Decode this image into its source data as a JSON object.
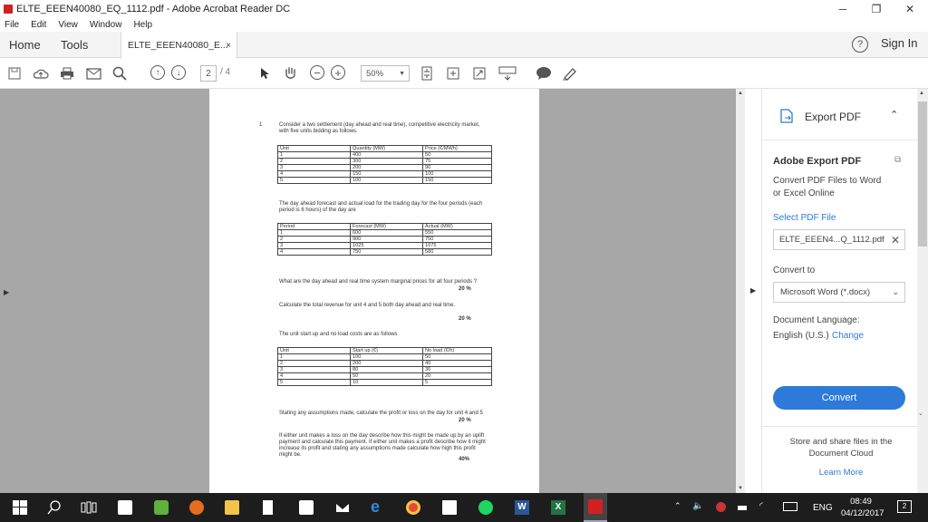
{
  "window": {
    "title": "ELTE_EEEN40080_EQ_1112.pdf - Adobe Acrobat Reader DC"
  },
  "menu": [
    "File",
    "Edit",
    "View",
    "Window",
    "Help"
  ],
  "tabs": {
    "home": "Home",
    "tools": "Tools",
    "document": "ELTE_EEEN40080_E...",
    "close": "×",
    "sign_in": "Sign In"
  },
  "toolbar": {
    "page_current": "2",
    "page_total": "/ 4",
    "zoom": "50%"
  },
  "panel": {
    "export_title": "Export PDF",
    "adobe_export": "Adobe Export PDF",
    "description": "Convert PDF Files to Word or Excel Online",
    "select_file": "Select PDF File",
    "file_name": "ELTE_EEEN4...Q_1112.pdf",
    "convert_to": "Convert to",
    "format": "Microsoft Word (*.docx)",
    "doc_language_label": "Document Language:",
    "language": "English (U.S.)",
    "change": "Change",
    "convert_button": "Convert",
    "store_text": "Store and share files in the Document Cloud",
    "learn_more": "Learn More"
  },
  "document": {
    "q_number": "1",
    "intro": "Consider a two settlement (day ahead and real time), competitive electricity market, with five units bidding as follows.",
    "table1": {
      "headers": [
        "Unit",
        "Quantity (MW)",
        "Price (€/MWh)"
      ],
      "rows": [
        [
          "1",
          "400",
          "50"
        ],
        [
          "2",
          "300",
          "75"
        ],
        [
          "3",
          "200",
          "90"
        ],
        [
          "4",
          "150",
          "100"
        ],
        [
          "5",
          "100",
          "150"
        ]
      ]
    },
    "forecast_text": "The day ahead forecast and actual load for the trading day for the four periods (each period is 6 hours) of the day are",
    "table2": {
      "headers": [
        "Period",
        "Forecast (MW)",
        "Actual (MW)"
      ],
      "rows": [
        [
          "1",
          "600",
          "550"
        ],
        [
          "2",
          "900",
          "750"
        ],
        [
          "3",
          "1025",
          "1075"
        ],
        [
          "4",
          "750",
          "580"
        ]
      ]
    },
    "q_a": "What are the day ahead and real time system marginal prices for all four periods ?",
    "q_a_pct": "20 %",
    "q_b": "Calculate the total revenue for unit 4 and 5 both day ahead and real time.",
    "q_b_pct": "20 %",
    "costs_text": "The unit start up and no load costs are as follows",
    "table3": {
      "headers": [
        "Unit",
        "Start up (€)",
        "No load (€/h)"
      ],
      "rows": [
        [
          "1",
          "100",
          "50"
        ],
        [
          "2",
          "200",
          "40"
        ],
        [
          "3",
          "80",
          "30"
        ],
        [
          "4",
          "50",
          "20"
        ],
        [
          "5",
          "10",
          "5"
        ]
      ]
    },
    "q_c": "Stating any assumptions made, calculate the profit or loss on the day for unit 4 and 5",
    "q_c_pct": "20 %",
    "q_d": "If either unit makes a loss on the day describe how this might be made up by an uplift payment and calculate this payment. If either unit makes a profit describe how it might increase its profit and stating any assumptions made calculate how high this profit might be.",
    "q_d_pct": "40%"
  },
  "taskbar": {
    "lang": "ENG",
    "time": "08:49",
    "date": "04/12/2017",
    "notifications": "2"
  }
}
